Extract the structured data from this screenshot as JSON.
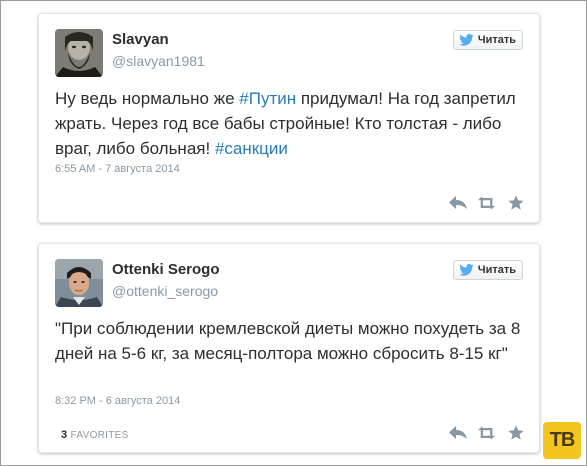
{
  "tweets": [
    {
      "author_name": "Slavyan",
      "author_handle": "@slavyan1981",
      "follow_label": "Читать",
      "text_parts": [
        {
          "text": "Ну ведь нормально же ",
          "hashtag": false
        },
        {
          "text": "#Путин",
          "hashtag": true
        },
        {
          "text": " придумал! На год запретил жрать. Через год все бабы стройные! Кто толстая - либо враг, либо больная! ",
          "hashtag": false
        },
        {
          "text": "#санкции",
          "hashtag": true
        }
      ],
      "timestamp": "6:55 AM - 7 августа 2014",
      "favorites_count": "",
      "favorites_label": "",
      "actions": [
        "reply-icon",
        "retweet-icon",
        "favorite-icon"
      ]
    },
    {
      "author_name": "Ottenki Serogo",
      "author_handle": "@ottenki_serogo",
      "follow_label": "Читать",
      "text_parts": [
        {
          "text": "\"При соблюдении кремлевской диеты можно похудеть за 8 дней на 5-6 кг, за месяц-полтора можно сбросить 8-15 кг\"",
          "hashtag": false
        }
      ],
      "timestamp": "8:32 PM - 6 августа 2014",
      "favorites_count": "3",
      "favorites_label": "FAVORITES",
      "actions": [
        "reply-icon",
        "retweet-icon",
        "favorite-icon"
      ]
    }
  ],
  "logo_text": "ТВ",
  "colors": {
    "hashtag": "#2b7bb9",
    "meta": "#8899a6",
    "text": "#292f33",
    "logo_bg": "#f4c51e",
    "twitter_bird": "#55acee"
  }
}
